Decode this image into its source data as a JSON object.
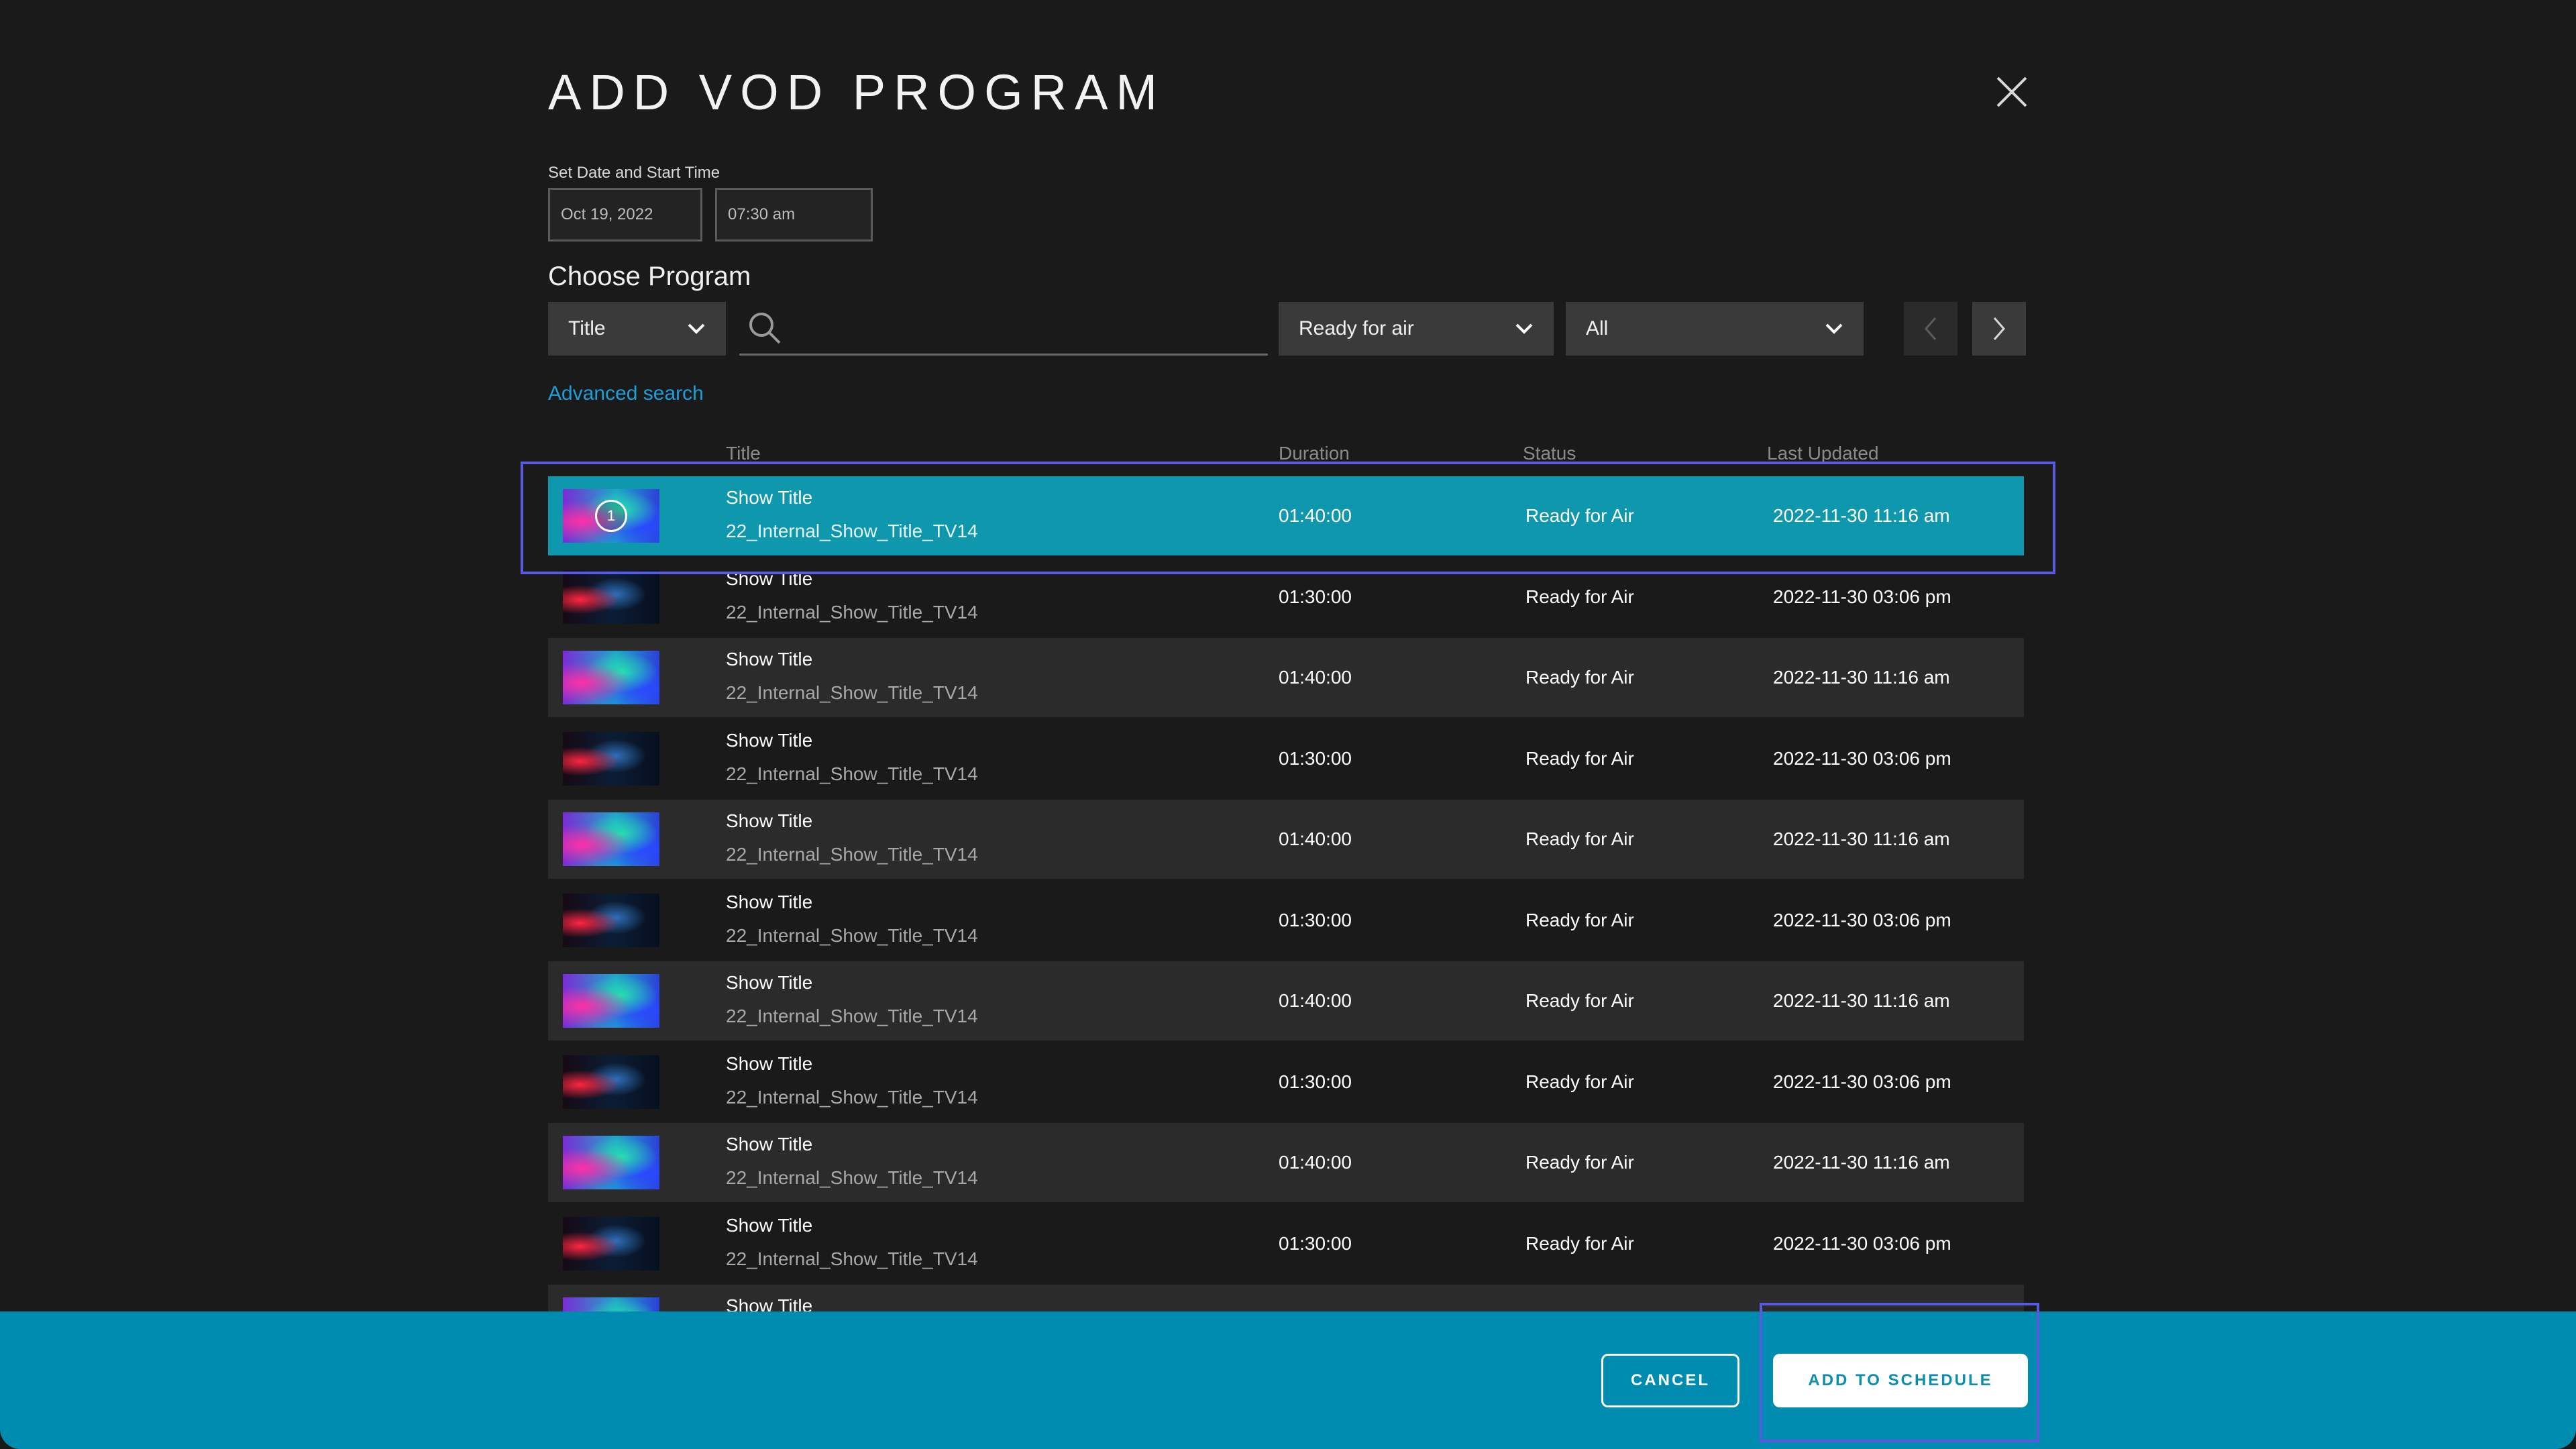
{
  "modal": {
    "title": "ADD VOD PROGRAM",
    "close_icon": "close-icon"
  },
  "datetime": {
    "label": "Set Date and Start Time",
    "date_value": "Oct 19, 2022",
    "time_value": "07:30 am"
  },
  "choose": {
    "label": "Choose Program",
    "field_select": "Title",
    "search_value": "",
    "status_select": "Ready for air",
    "filter_select": "All",
    "advanced_search": "Advanced search"
  },
  "table": {
    "headers": {
      "title": "Title",
      "duration": "Duration",
      "status": "Status",
      "last_updated": "Last Updated"
    },
    "rows": [
      {
        "title": "Show Title",
        "internal": "22_Internal_Show_Title_TV14",
        "duration": "01:40:00",
        "status": "Ready for Air",
        "updated": "2022-11-30 11:16 am",
        "thumb": "a",
        "selected": true,
        "badge": "1"
      },
      {
        "title": "Show Title",
        "internal": "22_Internal_Show_Title_TV14",
        "duration": "01:30:00",
        "status": "Ready for Air",
        "updated": "2022-11-30 03:06 pm",
        "thumb": "b"
      },
      {
        "title": "Show Title",
        "internal": "22_Internal_Show_Title_TV14",
        "duration": "01:40:00",
        "status": "Ready for Air",
        "updated": "2022-11-30 11:16 am",
        "thumb": "a"
      },
      {
        "title": "Show Title",
        "internal": "22_Internal_Show_Title_TV14",
        "duration": "01:30:00",
        "status": "Ready for Air",
        "updated": "2022-11-30 03:06 pm",
        "thumb": "b"
      },
      {
        "title": "Show Title",
        "internal": "22_Internal_Show_Title_TV14",
        "duration": "01:40:00",
        "status": "Ready for Air",
        "updated": "2022-11-30 11:16 am",
        "thumb": "a"
      },
      {
        "title": "Show Title",
        "internal": "22_Internal_Show_Title_TV14",
        "duration": "01:30:00",
        "status": "Ready for Air",
        "updated": "2022-11-30 03:06 pm",
        "thumb": "b"
      },
      {
        "title": "Show Title",
        "internal": "22_Internal_Show_Title_TV14",
        "duration": "01:40:00",
        "status": "Ready for Air",
        "updated": "2022-11-30 11:16 am",
        "thumb": "a"
      },
      {
        "title": "Show Title",
        "internal": "22_Internal_Show_Title_TV14",
        "duration": "01:30:00",
        "status": "Ready for Air",
        "updated": "2022-11-30 03:06 pm",
        "thumb": "b"
      },
      {
        "title": "Show Title",
        "internal": "22_Internal_Show_Title_TV14",
        "duration": "01:40:00",
        "status": "Ready for Air",
        "updated": "2022-11-30 11:16 am",
        "thumb": "a"
      },
      {
        "title": "Show Title",
        "internal": "22_Internal_Show_Title_TV14",
        "duration": "01:30:00",
        "status": "Ready for Air",
        "updated": "2022-11-30 03:06 pm",
        "thumb": "b"
      },
      {
        "title": "Show Title",
        "internal": "",
        "duration": "",
        "status": "",
        "updated": "",
        "thumb": "a"
      }
    ]
  },
  "footer": {
    "cancel_label": "CANCEL",
    "add_label": "ADD TO SCHEDULE"
  },
  "colors": {
    "background": "#1a1a1a",
    "selected_row": "#0e97ad",
    "footer": "#008bb0",
    "link": "#1e9ed8",
    "highlight_outline": "#5a5ae0"
  }
}
